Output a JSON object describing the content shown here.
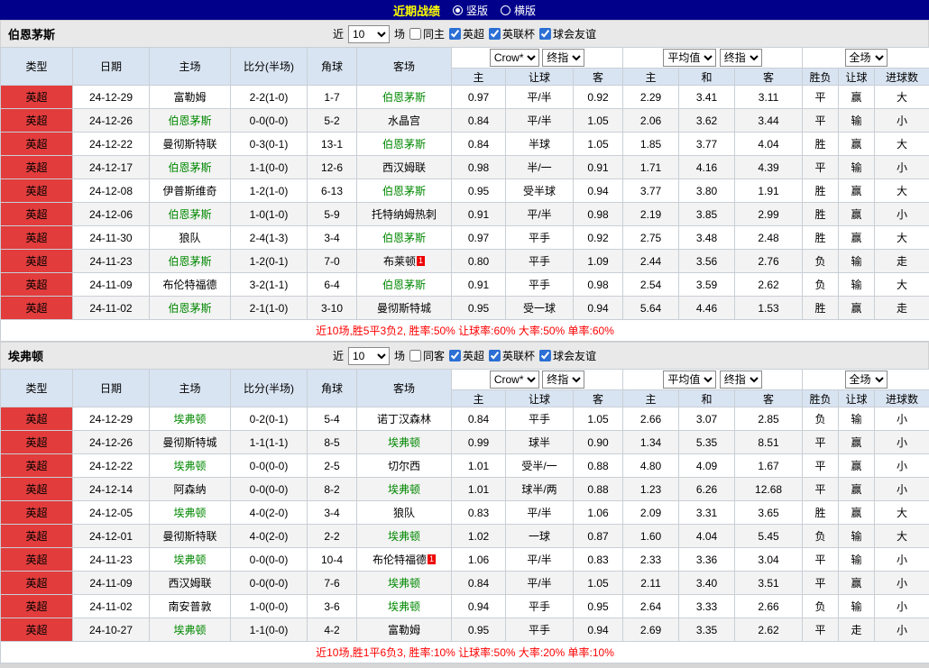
{
  "title_bar": {
    "title": "近期战绩",
    "vertical_label": "竖版",
    "horizontal_label": "横版"
  },
  "filter_labels": {
    "near": "近",
    "games": "场",
    "leagues": [
      "英超",
      "英联杯",
      "球会友谊"
    ]
  },
  "columns": {
    "type": "类型",
    "date": "日期",
    "home": "主场",
    "score": "比分(半场)",
    "corner": "角球",
    "away": "客场",
    "provider": "Crow*",
    "final_index": "终指",
    "average": "平均值",
    "full_match": "全场",
    "sub": [
      "主",
      "让球",
      "客",
      "主",
      "和",
      "客",
      "胜负",
      "让球",
      "进球数"
    ]
  },
  "colors": {
    "title_bar_bg": "#00008b",
    "title_text": "#ffff00",
    "league_cell_bg": "#e23c3c",
    "header_bg": "#d9e4f2",
    "win_text": "#ee0000",
    "lose_text": "#009900",
    "team_highlight": "#008800",
    "summary_text": "#ff0000"
  },
  "sections": [
    {
      "team": "伯恩茅斯",
      "match_count": "10",
      "same_filter": "同主",
      "summary": "近10场,胜5平3负2, 胜率:50% 让球率:60% 大率:50% 单率:60%",
      "rows": [
        {
          "type": "英超",
          "date": "24-12-29",
          "home": "富勒姆",
          "score": "2-2(1-0)",
          "corner": "1-7",
          "away": "伯恩茅斯",
          "o1": "0.97",
          "hcap": "平/半",
          "o2": "0.92",
          "a1": "2.29",
          "a2": "3.41",
          "a3": "3.11",
          "res": "平",
          "hres": "赢",
          "goals": "大"
        },
        {
          "type": "英超",
          "date": "24-12-26",
          "home": "伯恩茅斯",
          "score": "0-0(0-0)",
          "corner": "5-2",
          "away": "水晶宫",
          "o1": "0.84",
          "hcap": "平/半",
          "o2": "1.05",
          "a1": "2.06",
          "a2": "3.62",
          "a3": "3.44",
          "res": "平",
          "hres": "输",
          "goals": "小"
        },
        {
          "type": "英超",
          "date": "24-12-22",
          "home": "曼彻斯特联",
          "score": "0-3(0-1)",
          "corner": "13-1",
          "away": "伯恩茅斯",
          "o1": "0.84",
          "hcap": "半球",
          "o2": "1.05",
          "a1": "1.85",
          "a2": "3.77",
          "a3": "4.04",
          "res": "胜",
          "hres": "赢",
          "goals": "大"
        },
        {
          "type": "英超",
          "date": "24-12-17",
          "home": "伯恩茅斯",
          "score": "1-1(0-0)",
          "corner": "12-6",
          "away": "西汉姆联",
          "o1": "0.98",
          "hcap": "半/一",
          "o2": "0.91",
          "a1": "1.71",
          "a2": "4.16",
          "a3": "4.39",
          "res": "平",
          "hres": "输",
          "goals": "小"
        },
        {
          "type": "英超",
          "date": "24-12-08",
          "home": "伊普斯维奇",
          "score": "1-2(1-0)",
          "corner": "6-13",
          "away": "伯恩茅斯",
          "o1": "0.95",
          "hcap": "受半球",
          "o2": "0.94",
          "a1": "3.77",
          "a2": "3.80",
          "a3": "1.91",
          "res": "胜",
          "hres": "赢",
          "goals": "大"
        },
        {
          "type": "英超",
          "date": "24-12-06",
          "home": "伯恩茅斯",
          "score": "1-0(1-0)",
          "corner": "5-9",
          "away": "托特纳姆热刺",
          "o1": "0.91",
          "hcap": "平/半",
          "o2": "0.98",
          "a1": "2.19",
          "a2": "3.85",
          "a3": "2.99",
          "res": "胜",
          "hres": "赢",
          "goals": "小"
        },
        {
          "type": "英超",
          "date": "24-11-30",
          "home": "狼队",
          "score": "2-4(1-3)",
          "corner": "3-4",
          "away": "伯恩茅斯",
          "o1": "0.97",
          "hcap": "平手",
          "o2": "0.92",
          "a1": "2.75",
          "a2": "3.48",
          "a3": "2.48",
          "res": "胜",
          "hres": "赢",
          "goals": "大"
        },
        {
          "type": "英超",
          "date": "24-11-23",
          "home": "伯恩茅斯",
          "score": "1-2(0-1)",
          "corner": "7-0",
          "away": "布莱顿",
          "away_badge": "1",
          "o1": "0.80",
          "hcap": "平手",
          "o2": "1.09",
          "a1": "2.44",
          "a2": "3.56",
          "a3": "2.76",
          "res": "负",
          "hres": "输",
          "goals": "走"
        },
        {
          "type": "英超",
          "date": "24-11-09",
          "home": "布伦特福德",
          "score": "3-2(1-1)",
          "corner": "6-4",
          "away": "伯恩茅斯",
          "o1": "0.91",
          "hcap": "平手",
          "o2": "0.98",
          "a1": "2.54",
          "a2": "3.59",
          "a3": "2.62",
          "res": "负",
          "hres": "输",
          "goals": "大"
        },
        {
          "type": "英超",
          "date": "24-11-02",
          "home": "伯恩茅斯",
          "score": "2-1(1-0)",
          "corner": "3-10",
          "away": "曼彻斯特城",
          "o1": "0.95",
          "hcap": "受一球",
          "o2": "0.94",
          "a1": "5.64",
          "a2": "4.46",
          "a3": "1.53",
          "res": "胜",
          "hres": "赢",
          "goals": "走"
        }
      ]
    },
    {
      "team": "埃弗顿",
      "match_count": "10",
      "same_filter": "同客",
      "summary": "近10场,胜1平6负3, 胜率:10% 让球率:50% 大率:20% 单率:10%",
      "rows": [
        {
          "type": "英超",
          "date": "24-12-29",
          "home": "埃弗顿",
          "score": "0-2(0-1)",
          "corner": "5-4",
          "away": "诺丁汉森林",
          "o1": "0.84",
          "hcap": "平手",
          "o2": "1.05",
          "a1": "2.66",
          "a2": "3.07",
          "a3": "2.85",
          "res": "负",
          "hres": "输",
          "goals": "小"
        },
        {
          "type": "英超",
          "date": "24-12-26",
          "home": "曼彻斯特城",
          "score": "1-1(1-1)",
          "corner": "8-5",
          "away": "埃弗顿",
          "o1": "0.99",
          "hcap": "球半",
          "o2": "0.90",
          "a1": "1.34",
          "a2": "5.35",
          "a3": "8.51",
          "res": "平",
          "hres": "赢",
          "goals": "小"
        },
        {
          "type": "英超",
          "date": "24-12-22",
          "home": "埃弗顿",
          "score": "0-0(0-0)",
          "corner": "2-5",
          "away": "切尔西",
          "o1": "1.01",
          "hcap": "受半/一",
          "o2": "0.88",
          "a1": "4.80",
          "a2": "4.09",
          "a3": "1.67",
          "res": "平",
          "hres": "赢",
          "goals": "小"
        },
        {
          "type": "英超",
          "date": "24-12-14",
          "home": "阿森纳",
          "score": "0-0(0-0)",
          "corner": "8-2",
          "away": "埃弗顿",
          "o1": "1.01",
          "hcap": "球半/两",
          "o2": "0.88",
          "a1": "1.23",
          "a2": "6.26",
          "a3": "12.68",
          "res": "平",
          "hres": "赢",
          "goals": "小"
        },
        {
          "type": "英超",
          "date": "24-12-05",
          "home": "埃弗顿",
          "score": "4-0(2-0)",
          "corner": "3-4",
          "away": "狼队",
          "o1": "0.83",
          "hcap": "平/半",
          "o2": "1.06",
          "a1": "2.09",
          "a2": "3.31",
          "a3": "3.65",
          "res": "胜",
          "hres": "赢",
          "goals": "大"
        },
        {
          "type": "英超",
          "date": "24-12-01",
          "home": "曼彻斯特联",
          "score": "4-0(2-0)",
          "corner": "2-2",
          "away": "埃弗顿",
          "o1": "1.02",
          "hcap": "一球",
          "o2": "0.87",
          "a1": "1.60",
          "a2": "4.04",
          "a3": "5.45",
          "res": "负",
          "hres": "输",
          "goals": "大"
        },
        {
          "type": "英超",
          "date": "24-11-23",
          "home": "埃弗顿",
          "score": "0-0(0-0)",
          "corner": "10-4",
          "away": "布伦特福德",
          "away_badge": "1",
          "o1": "1.06",
          "hcap": "平/半",
          "o2": "0.83",
          "a1": "2.33",
          "a2": "3.36",
          "a3": "3.04",
          "res": "平",
          "hres": "输",
          "goals": "小"
        },
        {
          "type": "英超",
          "date": "24-11-09",
          "home": "西汉姆联",
          "score": "0-0(0-0)",
          "corner": "7-6",
          "away": "埃弗顿",
          "o1": "0.84",
          "hcap": "平/半",
          "o2": "1.05",
          "a1": "2.11",
          "a2": "3.40",
          "a3": "3.51",
          "res": "平",
          "hres": "赢",
          "goals": "小"
        },
        {
          "type": "英超",
          "date": "24-11-02",
          "home": "南安普敦",
          "score": "1-0(0-0)",
          "corner": "3-6",
          "away": "埃弗顿",
          "o1": "0.94",
          "hcap": "平手",
          "o2": "0.95",
          "a1": "2.64",
          "a2": "3.33",
          "a3": "2.66",
          "res": "负",
          "hres": "输",
          "goals": "小"
        },
        {
          "type": "英超",
          "date": "24-10-27",
          "home": "埃弗顿",
          "score": "1-1(0-0)",
          "corner": "4-2",
          "away": "富勒姆",
          "o1": "0.95",
          "hcap": "平手",
          "o2": "0.94",
          "a1": "2.69",
          "a2": "3.35",
          "a3": "2.62",
          "res": "平",
          "hres": "走",
          "goals": "小"
        }
      ]
    }
  ]
}
